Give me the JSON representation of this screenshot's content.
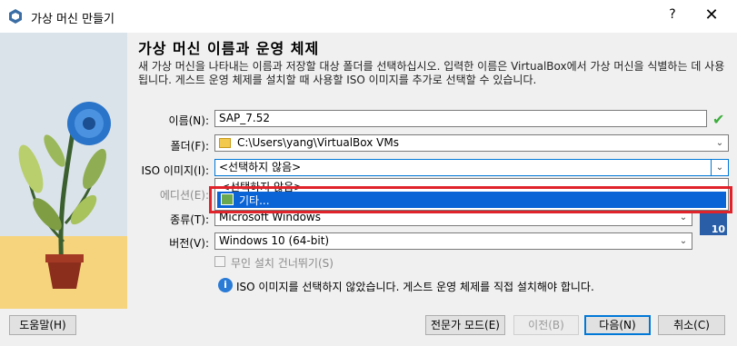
{
  "window": {
    "title": "가상 머신 만들기",
    "help_label": "?",
    "close_label": "✕"
  },
  "page": {
    "heading": "가상 머신 이름과 운영 체제",
    "description": "새 가상 머신을 나타내는 이름과 저장할 대상 폴더를 선택하십시오. 입력한 이름은 VirtualBox에서 가상 머신을 식별하는 데 사용됩니다. 게스트 운영 체제를 설치할 때 사용할 ISO 이미지를 추가로 선택할 수 있습니다."
  },
  "form": {
    "name_label": "이름(N):",
    "name_value": "SAP_7.52",
    "folder_label": "폴더(F):",
    "folder_value": "C:\\Users\\yang\\VirtualBox VMs",
    "iso_label": "ISO 이미지(I):",
    "iso_value": "<선택하지 않음>",
    "edition_label": "에디션(E):",
    "type_label": "종류(T):",
    "type_value": "Microsoft Windows",
    "version_label": "버전(V):",
    "version_value": "Windows 10 (64-bit)",
    "unattended_label": "무인 설치 건너뛰기(S)",
    "info_text": "ISO 이미지를 선택하지 않았습니다. 게스트 운영 체제를 직접 설치해야 합니다.",
    "os_badge": "10"
  },
  "iso_dropdown": {
    "items": [
      "<선택하지 않음>",
      "기타..."
    ],
    "selected_index": 1
  },
  "buttons": {
    "help": "도움말(H)",
    "expert": "전문가 모드(E)",
    "back": "이전(B)",
    "next": "다음(N)",
    "cancel": "취소(C)"
  },
  "icons": {
    "app": "virtualbox-icon",
    "valid": "green-check-icon",
    "folder": "folder-icon",
    "info": "info-icon",
    "other": "image-file-icon"
  }
}
